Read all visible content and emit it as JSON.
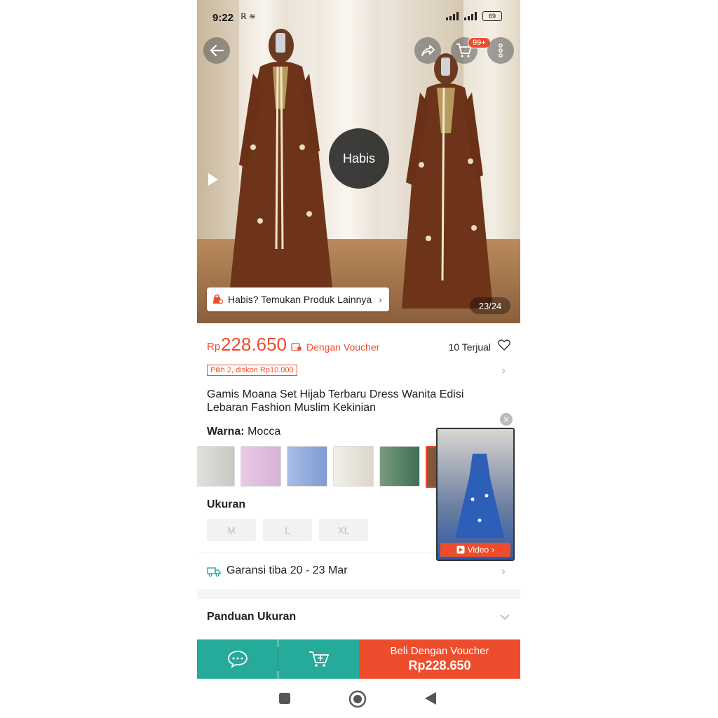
{
  "status_bar": {
    "time": "9:22",
    "battery": "69"
  },
  "hero": {
    "cart_badge": "99+",
    "sold_out_label": "Habis",
    "other_products_label": "Habis? Temukan Produk Lainnya",
    "image_counter": "23/24"
  },
  "price": {
    "currency": "Rp",
    "amount": "228.650",
    "voucher_label": "Dengan Voucher",
    "sold": "10 Terjual"
  },
  "promo": "Pilih 2, diskon Rp10.000",
  "product_title": "Gamis Moana Set Hijab Terbaru Dress Wanita Edisi Lebaran Fashion Muslim Kekinian",
  "variant": {
    "label": "Warna:",
    "value": "Mocca"
  },
  "size_section": {
    "label": "Ukuran",
    "options": [
      "M",
      "L",
      "XL"
    ]
  },
  "shipping": "Garansi tiba 20 - 23 Mar",
  "size_guide": "Panduan Ukuran",
  "video_popup": {
    "label": "Video"
  },
  "bottom_bar": {
    "buy_label": "Beli Dengan Voucher",
    "buy_price": "Rp228.650"
  },
  "colors": {
    "accent": "#ee4d2d",
    "teal": "#26aa99"
  }
}
